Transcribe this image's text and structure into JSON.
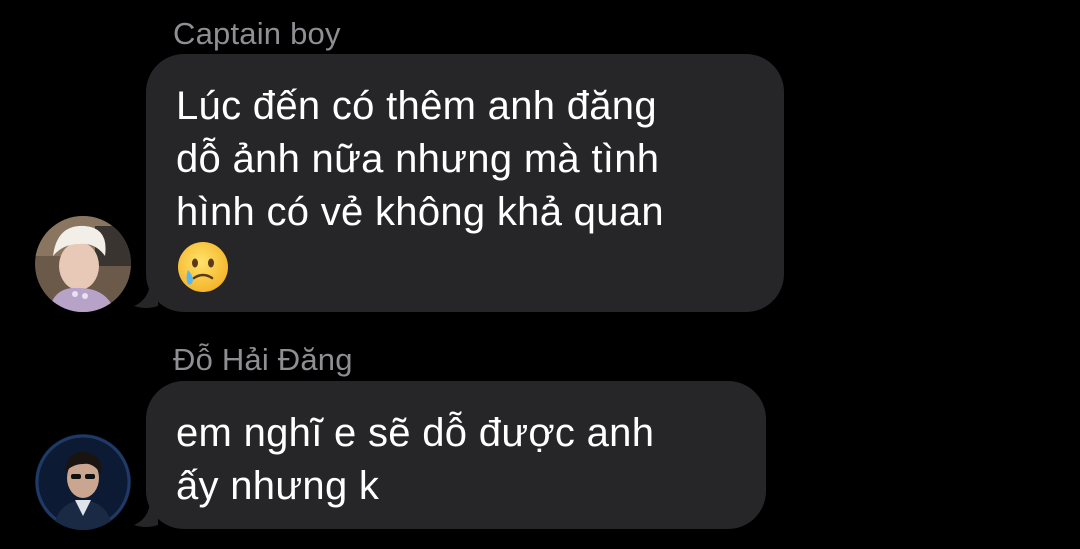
{
  "messages": [
    {
      "sender": "Captain boy",
      "avatar_icon": "avatar-blonde-user",
      "lines": [
        "Lúc đến có thêm anh đăng",
        "dỗ ảnh nữa nhưng mà tình",
        "hình có vẻ không khả quan"
      ],
      "emoji": "face-holding-back-tears"
    },
    {
      "sender": "Đỗ Hải Đăng",
      "avatar_icon": "avatar-dark-user",
      "lines": [
        "em nghĩ e sẽ dỗ được anh",
        "ấy nhưng k"
      ]
    }
  ],
  "colors": {
    "background": "#000000",
    "bubble": "#262628",
    "sender_name": "#8e8e93",
    "message_text": "#ffffff"
  }
}
